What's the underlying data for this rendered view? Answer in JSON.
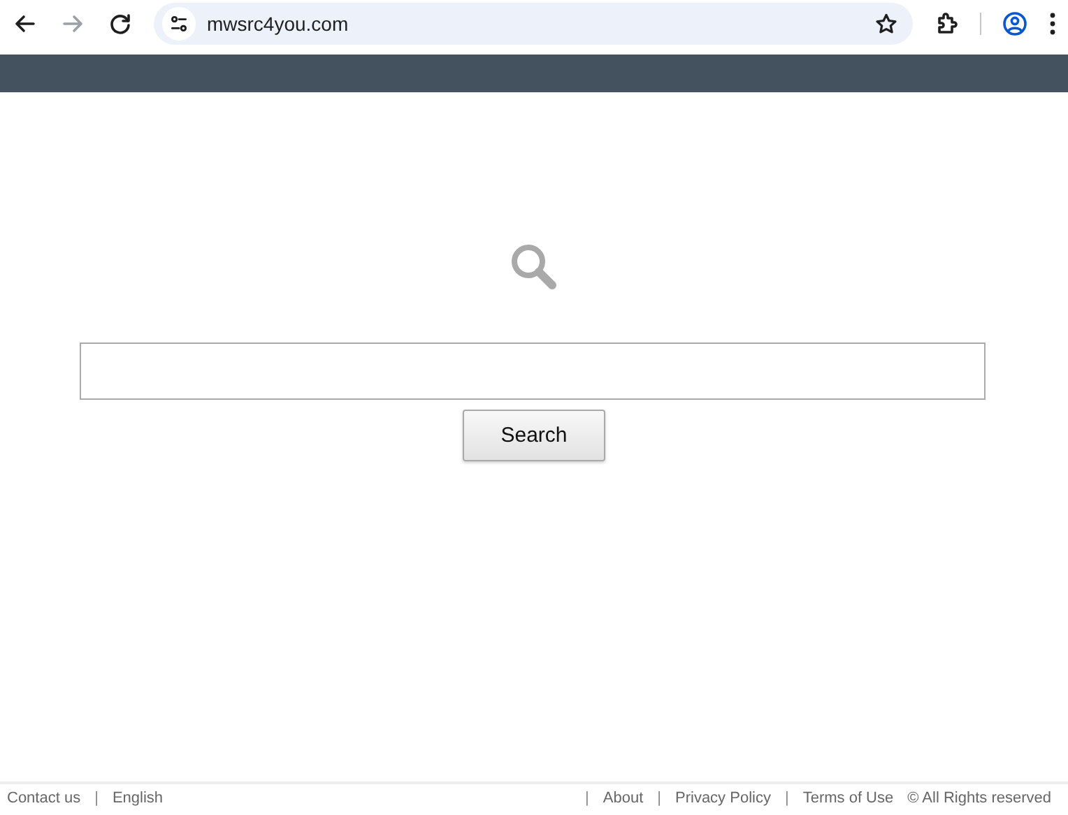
{
  "browser": {
    "url": "mwsrc4you.com"
  },
  "search": {
    "button": "Search"
  },
  "footer": {
    "left": [
      {
        "kind": "link",
        "text": "Contact us"
      },
      {
        "kind": "separator",
        "text": "|"
      },
      {
        "kind": "link",
        "text": "English"
      }
    ],
    "right": [
      {
        "kind": "separator",
        "text": "|"
      },
      {
        "kind": "link",
        "text": "About"
      },
      {
        "kind": "separator",
        "text": "|"
      },
      {
        "kind": "link",
        "text": "Privacy Policy"
      },
      {
        "kind": "separator",
        "text": "|"
      },
      {
        "kind": "link",
        "text": "Terms of Use"
      },
      {
        "kind": "note",
        "text": "© All Rights reserved"
      }
    ]
  }
}
